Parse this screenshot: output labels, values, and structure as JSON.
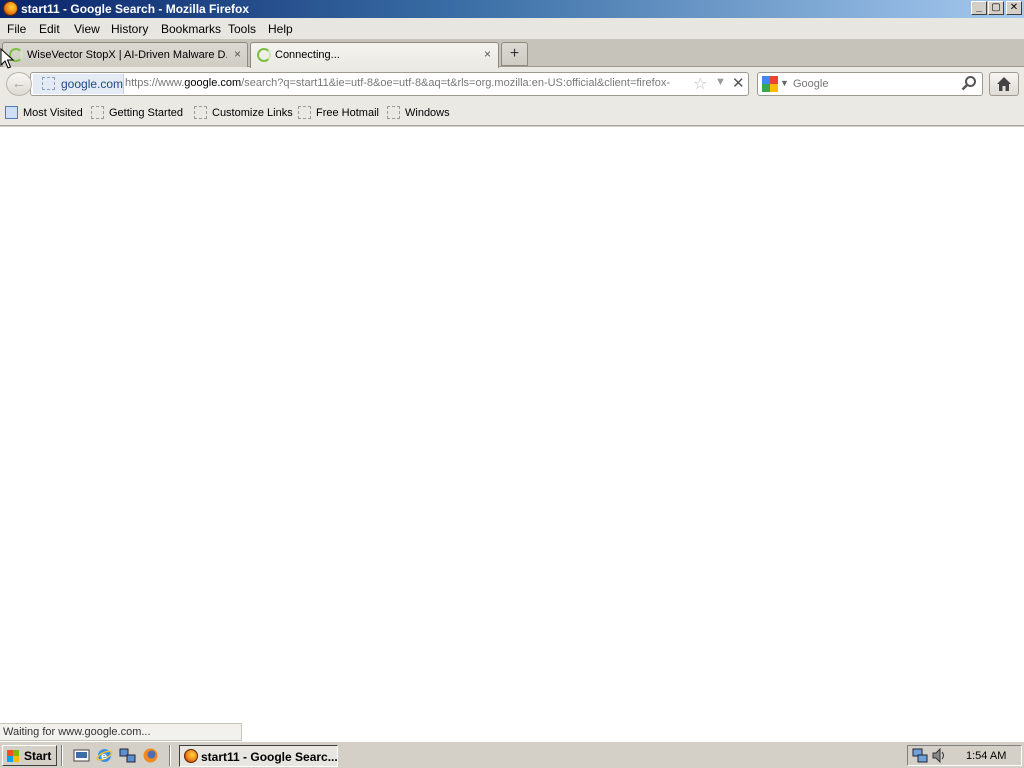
{
  "window": {
    "title": "start11 - Google Search - Mozilla Firefox",
    "controls": {
      "minimize": "_",
      "maximize": "▢",
      "close": "✕"
    }
  },
  "menu": [
    "File",
    "Edit",
    "View",
    "History",
    "Bookmarks",
    "Tools",
    "Help"
  ],
  "tabs": [
    {
      "label": "WiseVector StopX | AI-Driven Malware D...",
      "active": false,
      "icon": "loading-spinner-icon"
    },
    {
      "label": "Connecting...",
      "active": true,
      "icon": "loading-spinner-icon"
    }
  ],
  "tab_close": "×",
  "new_tab": "+",
  "navbar": {
    "back_icon": "back-arrow-icon",
    "site_identity": "google.com",
    "url_prefix": "https://www.",
    "url_host": "google.com",
    "url_rest": "/search?q=start11&ie=utf-8&oe=utf-8&aq=t&rls=org.mozilla:en-US:official&client=firefox-",
    "star": "☆",
    "dropdown": "▼",
    "stop": "✕",
    "search_placeholder": "Google",
    "search_icon": "magnifier-icon",
    "home_icon": "home-icon"
  },
  "bookmarks": [
    "Most Visited",
    "Getting Started",
    "Customize Links",
    "Free Hotmail",
    "Windows"
  ],
  "status": "Waiting for www.google.com...",
  "taskbar": {
    "start": "Start",
    "task_label": "start11 - Google Searc...",
    "clock": "1:54 AM"
  },
  "colors": {
    "titlebar_start": "#0a246a",
    "titlebar_end": "#a6caf0",
    "chrome": "#d4d0c8",
    "spinner": "#7ac142"
  }
}
